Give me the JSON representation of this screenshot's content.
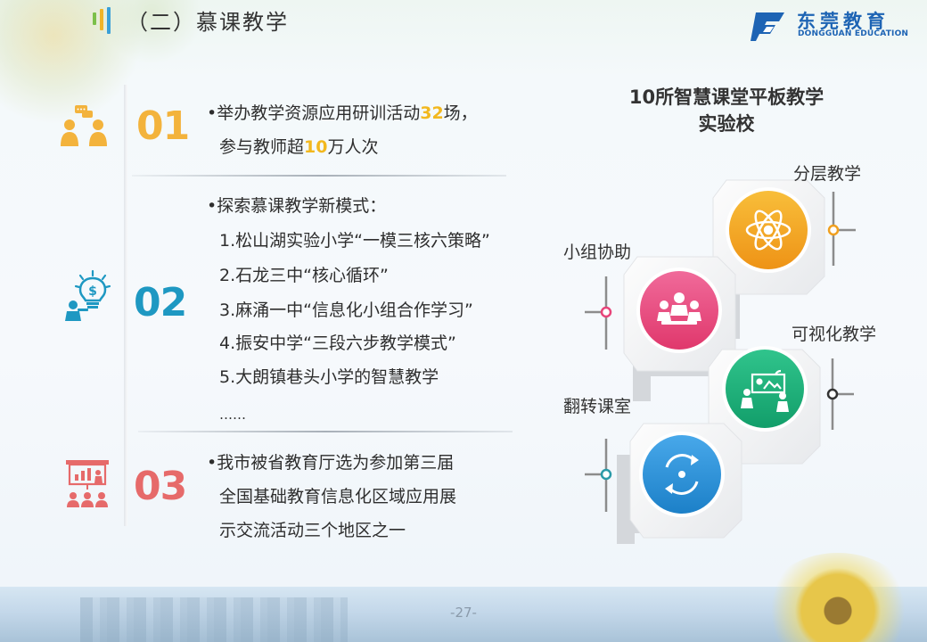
{
  "header": {
    "title": "（二）慕课教学",
    "logo_cn": "东莞教育",
    "logo_en": "DONGGUAN EDUCATION"
  },
  "sections": [
    {
      "number": "01",
      "icon": "people-chat-icon",
      "color": "#f3b33c",
      "lines": {
        "l1_pre": "•举办教学资源应用研训活动",
        "l1_hl": "32",
        "l1_post": "场，",
        "l2_pre": "参与教师超",
        "l2_hl": "10",
        "l2_post": "万人次"
      }
    },
    {
      "number": "02",
      "icon": "idea-bulb-icon",
      "color": "#1e98c2",
      "lines": [
        "•探索慕课教学新模式：",
        "1.松山湖实验小学“一模三核六策略”",
        "2.石龙三中“核心循环”",
        "3.麻涌一中“信息化小组合作学习”",
        "4.振安中学“三段六步教学模式”",
        "5.大朗镇巷头小学的智慧教学",
        "……"
      ]
    },
    {
      "number": "03",
      "icon": "presentation-audience-icon",
      "color": "#e66a6a",
      "lines": [
        "•我市被省教育厅选为参加第三届",
        "全国基础教育信息化区域应用展",
        "示交流活动三个地区之一"
      ]
    }
  ],
  "right": {
    "title_line1": "10所智慧课堂平板教学",
    "title_line2": "实验校",
    "features": [
      {
        "label": "分层教学",
        "icon": "atom-icon",
        "color": "#f0a020"
      },
      {
        "label": "小组协助",
        "icon": "group-meeting-icon",
        "color": "#e8457a"
      },
      {
        "label": "可视化教学",
        "icon": "video-conference-icon",
        "color": "#1aae7a"
      },
      {
        "label": "翻转课室",
        "icon": "rotate-arrows-icon",
        "color": "#2a8fd6"
      }
    ]
  },
  "footer": {
    "page_number": "-27-"
  }
}
